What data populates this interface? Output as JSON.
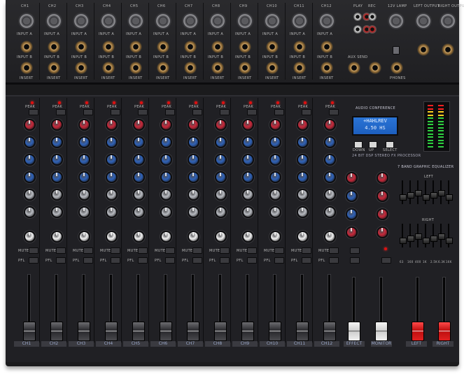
{
  "top_panel": {
    "channel_labels": [
      "CH1",
      "CH2",
      "CH3",
      "CH4",
      "CH5",
      "CH6",
      "CH7",
      "CH8",
      "CH9",
      "CH10",
      "CH11",
      "CH12"
    ],
    "play_label": "PLAY",
    "rec_label": "REC",
    "lamp_label": "12V LAMP",
    "left_output_label": "LEFT OUTPUT",
    "right_output_label": "RIGHT OUTPUT",
    "mic_input_label": "INPUT A",
    "line_input_label": "INPUT B",
    "insert_label": "INSERT",
    "aux_label": "AUX SEND",
    "phones_label": "PHONES"
  },
  "effects": {
    "title": "AUDIO CONFERENCE",
    "subtitle": "24 BIT DSP STEREO FX PROCESSOR",
    "lcd_line1": "+HAHLREV",
    "lcd_line2": "4.50 HS",
    "buttons": [
      "DOWN",
      "UP",
      "SELECT"
    ]
  },
  "equalizer": {
    "title": "7 BAND GRAPHIC EQUALIZER",
    "left_label": "LEFT",
    "right_label": "RIGHT",
    "bands": [
      "63",
      "160",
      "400",
      "1K",
      "2.5K",
      "6.3K",
      "16K"
    ]
  },
  "channels": {
    "names": [
      "CH1",
      "CH2",
      "CH3",
      "CH4",
      "CH5",
      "CH6",
      "CH7",
      "CH8",
      "CH9",
      "CH10",
      "CH11",
      "CH12"
    ],
    "peak_label": "PEAK",
    "mute_label": "MUTE",
    "pfl_label": "PFL"
  },
  "master": {
    "effect_label": "EFFECT",
    "monitor_label": "MONITOR",
    "left_label": "LEFT",
    "right_label": "RIGHT"
  },
  "colors": {
    "knob_red": "#c8283a",
    "knob_blue": "#2f62b8",
    "knob_gray": "#b9bcc2",
    "knob_white": "#f2f2f2",
    "lcd_blue": "#1d5fbf"
  }
}
